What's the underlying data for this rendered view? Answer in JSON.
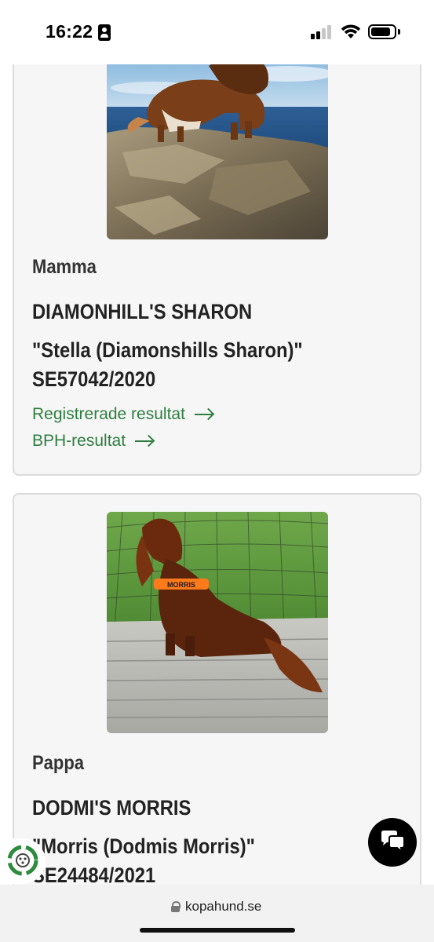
{
  "status_bar": {
    "time": "16:22"
  },
  "cards": [
    {
      "role": "Mamma",
      "name": "DIAMONHILL'S SHARON",
      "nickname": "\"Stella (Diamonshills Sharon)\"",
      "reg_number": "SE57042/2020",
      "links": [
        "Registrerade resultat",
        "BPH-resultat"
      ],
      "photo": "long-haired dachshund standing on rock by the sea"
    },
    {
      "role": "Pappa",
      "name": "DODMI'S MORRIS",
      "nickname": "\"Morris (Dodmis Morris)\"",
      "reg_number": "SE24484/2021",
      "photo": "long-haired dachshund with orange harness sitting on wooden deck"
    }
  ],
  "browser": {
    "url": "kopahund.se"
  },
  "icons": {
    "chat": "chat-bubbles-icon",
    "recycle": "recycle-badge-icon",
    "lock": "lock-icon",
    "link_arrow": "arrow-right-icon"
  },
  "colors": {
    "link": "#2e7d40",
    "card_bg": "#f6f6f6",
    "card_border": "#dcdcdc"
  }
}
